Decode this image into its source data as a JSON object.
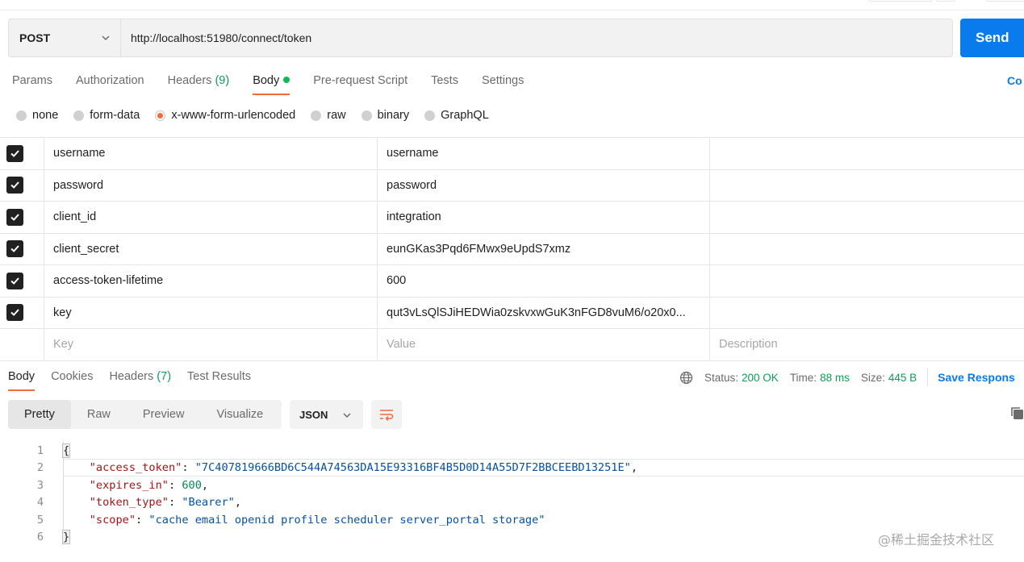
{
  "request": {
    "method": "POST",
    "url": "http://localhost:51980/connect/token",
    "send_label": "Send"
  },
  "request_tabs": [
    {
      "label": "Params"
    },
    {
      "label": "Authorization"
    },
    {
      "label": "Headers",
      "count": "(9)"
    },
    {
      "label": "Body",
      "active": true,
      "indicator": "green-dot-icon"
    },
    {
      "label": "Pre-request Script"
    },
    {
      "label": "Tests"
    },
    {
      "label": "Settings"
    }
  ],
  "cookies_link": "Co",
  "body_types": {
    "selected": "x-www-form-urlencoded",
    "options": [
      "none",
      "form-data",
      "x-www-form-urlencoded",
      "raw",
      "binary",
      "GraphQL"
    ]
  },
  "params": {
    "rows": [
      {
        "key": "username",
        "value": "username",
        "checked": true
      },
      {
        "key": "password",
        "value": "password",
        "checked": true
      },
      {
        "key": "client_id",
        "value": "integration",
        "checked": true
      },
      {
        "key": "client_secret",
        "value": "eunGKas3Pqd6FMwx9eUpdS7xmz",
        "checked": true
      },
      {
        "key": "access-token-lifetime",
        "value": "600",
        "checked": true
      },
      {
        "key": "key",
        "value": "qut3vLsQlSJiHEDWia0zskvxwGuK3nFGD8vuM6/o20x0...",
        "checked": true
      }
    ],
    "placeholder": {
      "key": "Key",
      "value": "Value",
      "description": "Description"
    }
  },
  "response": {
    "tabs": [
      {
        "label": "Body",
        "active": true
      },
      {
        "label": "Cookies"
      },
      {
        "label": "Headers",
        "count": "(7)"
      },
      {
        "label": "Test Results"
      }
    ],
    "status_label": "Status:",
    "status_value": "200 OK",
    "time_label": "Time:",
    "time_value": "88 ms",
    "size_label": "Size:",
    "size_value": "445 B",
    "save_label": "Save Respons",
    "views": [
      "Pretty",
      "Raw",
      "Preview",
      "Visualize"
    ],
    "active_view": "Pretty",
    "format": "JSON",
    "code_lines": {
      "l1": "{",
      "l2_key": "\"access_token\"",
      "l2_val": "\"7C407819666BD6C544A74563DA15E93316BF4B5D0D14A55D7F2BBCEEBD13251E\"",
      "l3_key": "\"expires_in\"",
      "l3_val": "600",
      "l4_key": "\"token_type\"",
      "l4_val": "\"Bearer\"",
      "l5_key": "\"scope\"",
      "l5_val": "\"cache email openid profile scheduler server_portal storage\"",
      "l6": "}"
    },
    "line_numbers": [
      "1",
      "2",
      "3",
      "4",
      "5",
      "6"
    ]
  },
  "watermark": "@稀土掘金技术社区"
}
